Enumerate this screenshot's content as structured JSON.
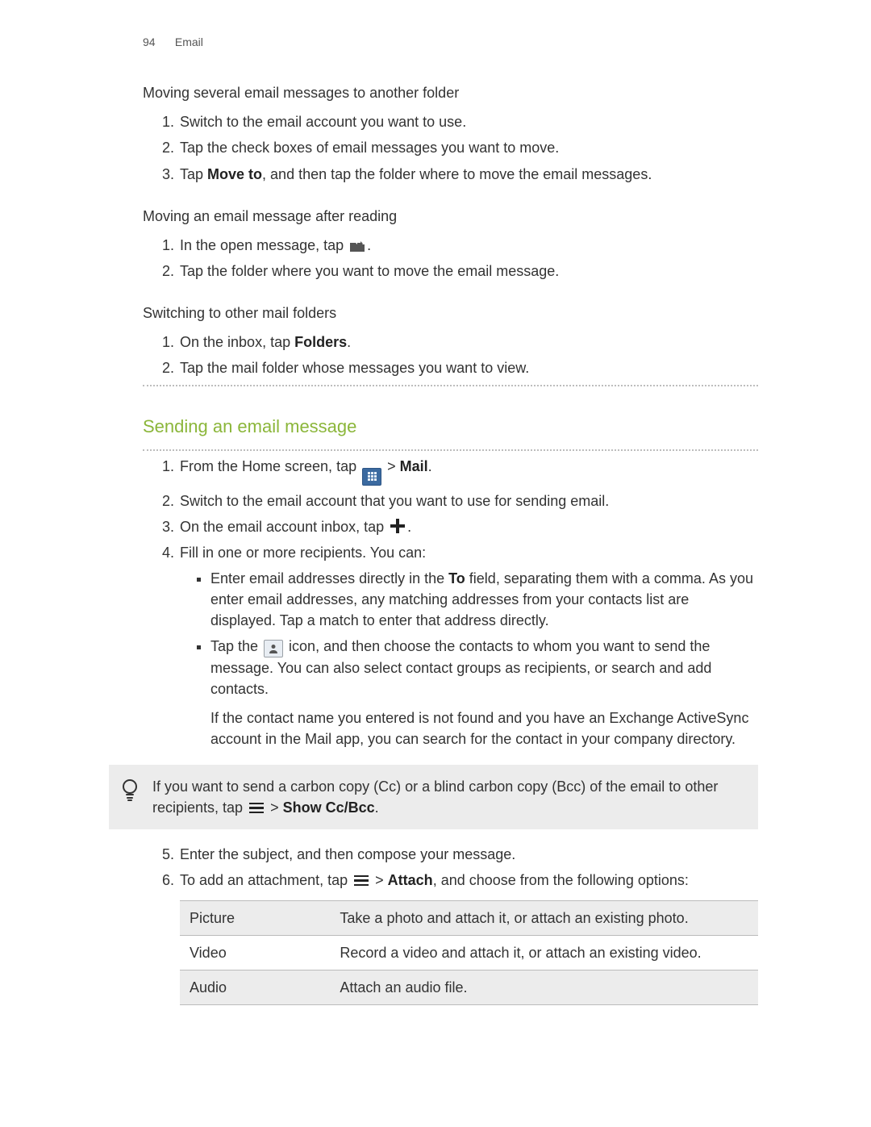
{
  "header": {
    "page_number": "94",
    "section": "Email"
  },
  "s1": {
    "title": "Moving several email messages to another folder",
    "steps": [
      "Switch to the email account you want to use.",
      "Tap the check boxes of email messages you want to move.",
      {
        "pre": "Tap ",
        "b1": "Move to",
        "post": ", and then tap the folder where to move the email messages."
      }
    ]
  },
  "s2": {
    "title": "Moving an email message after reading",
    "steps": [
      {
        "pre": "In the open message, tap ",
        "post": "."
      },
      "Tap the folder where you want to move the email message."
    ]
  },
  "s3": {
    "title": "Switching to other mail folders",
    "steps": [
      {
        "pre": "On the inbox, tap ",
        "b1": "Folders",
        "post": "."
      },
      "Tap the mail folder whose messages you want to view."
    ]
  },
  "sending": {
    "title": "Sending an email message",
    "steps": {
      "s1": {
        "pre": "From the Home screen, tap ",
        "mid": " > ",
        "b1": "Mail",
        "post": "."
      },
      "s2": "Switch to the email account that you want to use for sending email.",
      "s3": {
        "pre": "On the email account inbox, tap ",
        "post": "."
      },
      "s4": "Fill in one or more recipients. You can:",
      "s5": "Enter the subject, and then compose your message.",
      "s6": {
        "pre": "To add an attachment, tap ",
        "mid": " > ",
        "b1": "Attach",
        "post": ", and choose from the following options:"
      }
    },
    "bullets": {
      "b1": {
        "pre": "Enter email addresses directly in the ",
        "bold": "To",
        "post": " field, separating them with a comma. As you enter email addresses, any matching addresses from your contacts list are displayed. Tap a match to enter that address directly."
      },
      "b2": {
        "pre": "Tap the ",
        "post": " icon, and then choose the contacts to whom you want to send the message. You can also select contact groups as recipients, or search and add contacts."
      },
      "note": "If the contact name you entered is not found and you have an Exchange ActiveSync account in the Mail app, you can search for the contact in your company directory."
    },
    "tip": {
      "pre": "If you want to send a carbon copy (Cc) or a blind carbon copy (Bcc) of the email to other recipients, tap ",
      "mid": " > ",
      "b1": "Show Cc/Bcc",
      "post": "."
    },
    "table": [
      {
        "k": "Picture",
        "v": "Take a photo and attach it, or attach an existing photo."
      },
      {
        "k": "Video",
        "v": "Record a video and attach it, or attach an existing video."
      },
      {
        "k": "Audio",
        "v": "Attach an audio file."
      }
    ]
  }
}
